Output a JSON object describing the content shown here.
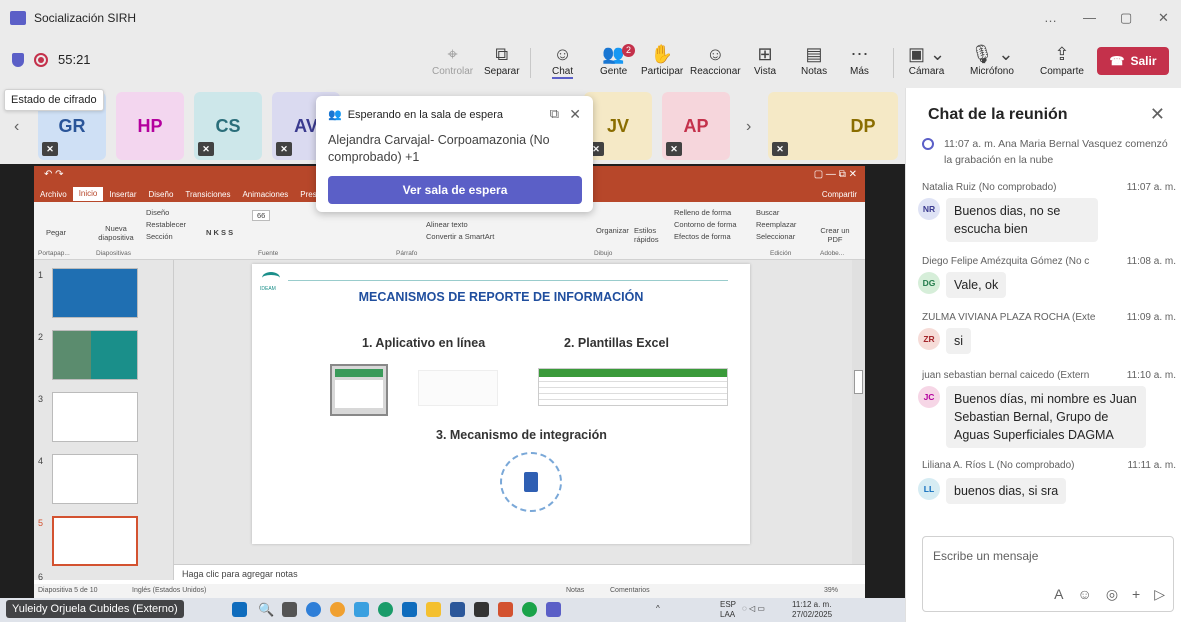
{
  "window": {
    "title": "Socialización SIRH",
    "controls": [
      "…",
      "—",
      "▢",
      "✕"
    ]
  },
  "toolbar": {
    "timer": "55:21",
    "controlar": "Controlar",
    "separar": "Separar",
    "chat": "Chat",
    "gente": "Gente",
    "gente_badge": "2",
    "participar": "Participar",
    "reaccionar": "Reaccionar",
    "vista": "Vista",
    "notas": "Notas",
    "mas": "Más",
    "camara": "Cámara",
    "microfono": "Micrófono",
    "comparte": "Comparte",
    "salir": "Salir"
  },
  "tooltip": "Estado de cifrado",
  "participants": [
    {
      "initials": "GR",
      "color": "#2a5599",
      "bg": "#cfe0f5"
    },
    {
      "initials": "HP",
      "color": "#b4009e",
      "bg": "#f3d6ef"
    },
    {
      "initials": "CS",
      "color": "#2a6e7a",
      "bg": "#cde7ea"
    },
    {
      "initials": "AV",
      "color": "#3b3b8f",
      "bg": "#dadaf0"
    },
    {
      "initials": "JV",
      "color": "#8a6d00",
      "bg": "#f5e9c6"
    },
    {
      "initials": "AP",
      "color": "#c4314b",
      "bg": "#f6d6dc"
    },
    {
      "initials": "DP",
      "color": "#8a6d00",
      "bg": "#f5e9c6"
    }
  ],
  "lobby": {
    "header": "Esperando en la sala de espera",
    "body": "Alejandra Carvajal- Corpoamazonia (No comprobado) +1",
    "button": "Ver sala de espera"
  },
  "ppt": {
    "tabs": [
      "Archivo",
      "Inicio",
      "Insertar",
      "Diseño",
      "Transiciones",
      "Animaciones",
      "Pres"
    ],
    "share": "Compartir",
    "ribbon": {
      "pegar": "Pegar",
      "nueva": "Nueva diapositiva",
      "diseno": "Diseño",
      "restablecer": "Restablecer",
      "seccion": "Sección",
      "fontsize": "66",
      "alinear": "Alinear texto",
      "convertir": "Convertir a SmartArt",
      "organizar": "Organizar",
      "estilos": "Estilos rápidos",
      "relleno": "Relleno de forma",
      "contorno": "Contorno de forma",
      "efectos": "Efectos de forma",
      "buscar": "Buscar",
      "reemplazar": "Reemplazar",
      "seleccionar": "Seleccionar",
      "crear": "Crear un PDF",
      "groups": [
        "Portapap...",
        "Diapositivas",
        "Fuente",
        "Párrafo",
        "Dibujo",
        "Edición",
        "Adobe..."
      ]
    },
    "slide_numbers": [
      "1",
      "2",
      "3",
      "4",
      "5",
      "6"
    ],
    "slide": {
      "logo": "IDEAM",
      "title": "MECANISMOS DE REPORTE DE INFORMACIÓN",
      "item1": "1. Aplicativo en línea",
      "item2": "2. Plantillas Excel",
      "item3": "3. Mecanismo de integración"
    },
    "notes_placeholder": "Haga clic para agregar notas",
    "status_left": "Diapositiva 5 de 10",
    "status_lang": "Inglés (Estados Unidos)",
    "status_notas": "Notas",
    "status_comentarios": "Comentarios",
    "zoom": "39%"
  },
  "speaker": "Yuleidy Orjuela Cubides (Externo)",
  "tray": {
    "lang": "ESP",
    "lang2": "LAA",
    "time": "11:12 a. m.",
    "date": "27/02/2025"
  },
  "chat": {
    "title": "Chat de la reunión",
    "system": "11:07 a. m.  Ana Maria Bernal Vasquez comenzó la grabación en la nube",
    "messages": [
      {
        "name": "Natalia Ruiz (No comprobado)",
        "time": "11:07 a. m.",
        "initials": "NR",
        "text": "Buenos dias, no se escucha bien",
        "avbg": "#dfe3f5",
        "avfg": "#3b3b8f"
      },
      {
        "name": "Diego Felipe Amézquita Gómez (No c",
        "time": "11:08 a. m.",
        "initials": "DG",
        "text": "Vale, ok",
        "avbg": "#d6eed9",
        "avfg": "#237b4b"
      },
      {
        "name": "ZULMA VIVIANA PLAZA ROCHA (Exte",
        "time": "11:09 a. m.",
        "initials": "ZR",
        "text": "si",
        "avbg": "#f6dcd8",
        "avfg": "#a4262c"
      },
      {
        "name": "juan sebastian bernal caicedo (Extern",
        "time": "11:10 a. m.",
        "initials": "JC",
        "text": "Buenos días, mi nombre es Juan Sebastian Bernal, Grupo de Aguas Superficiales DAGMA",
        "avbg": "#f6d6e6",
        "avfg": "#b4009e"
      },
      {
        "name": "Liliana A. Ríos L (No comprobado)",
        "time": "11:11 a. m.",
        "initials": "LL",
        "text": "buenos dias, si sra",
        "avbg": "#d6ecf3",
        "avfg": "#0f6cbd"
      }
    ],
    "placeholder": "Escribe un mensaje"
  }
}
